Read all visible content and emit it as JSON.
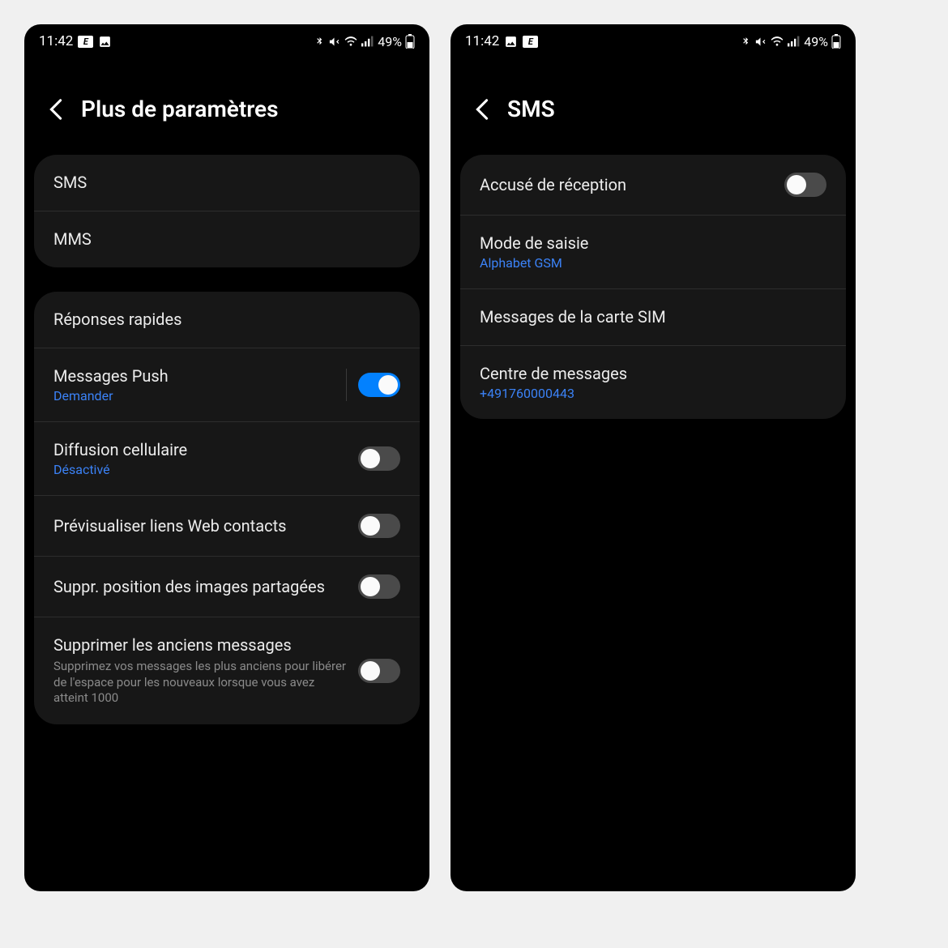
{
  "status_bar": {
    "time": "11:42",
    "battery_text": "49%"
  },
  "screen_left": {
    "title": "Plus de paramètres",
    "group1": {
      "sms": "SMS",
      "mms": "MMS"
    },
    "group2": {
      "quick_replies": "Réponses rapides",
      "push": {
        "title": "Messages Push",
        "sub": "Demander",
        "on": true
      },
      "cell_broadcast": {
        "title": "Diffusion cellulaire",
        "sub": "Désactivé",
        "on": false
      },
      "preview_links": {
        "title": "Prévisualiser liens Web contacts",
        "on": false
      },
      "strip_location": {
        "title": "Suppr. position des images partagées",
        "on": false
      },
      "delete_old": {
        "title": "Supprimer les anciens messages",
        "desc": "Supprimez vos messages les plus anciens pour libérer de l'espace pour les nouveaux lorsque vous avez atteint 1000",
        "on": false
      }
    }
  },
  "screen_right": {
    "title": "SMS",
    "rows": {
      "delivery_report": {
        "title": "Accusé de réception",
        "on": false
      },
      "input_mode": {
        "title": "Mode de saisie",
        "sub": "Alphabet GSM"
      },
      "sim_messages": {
        "title": "Messages de la carte SIM"
      },
      "message_center": {
        "title": "Centre de messages",
        "sub": "+491760000443"
      }
    }
  }
}
